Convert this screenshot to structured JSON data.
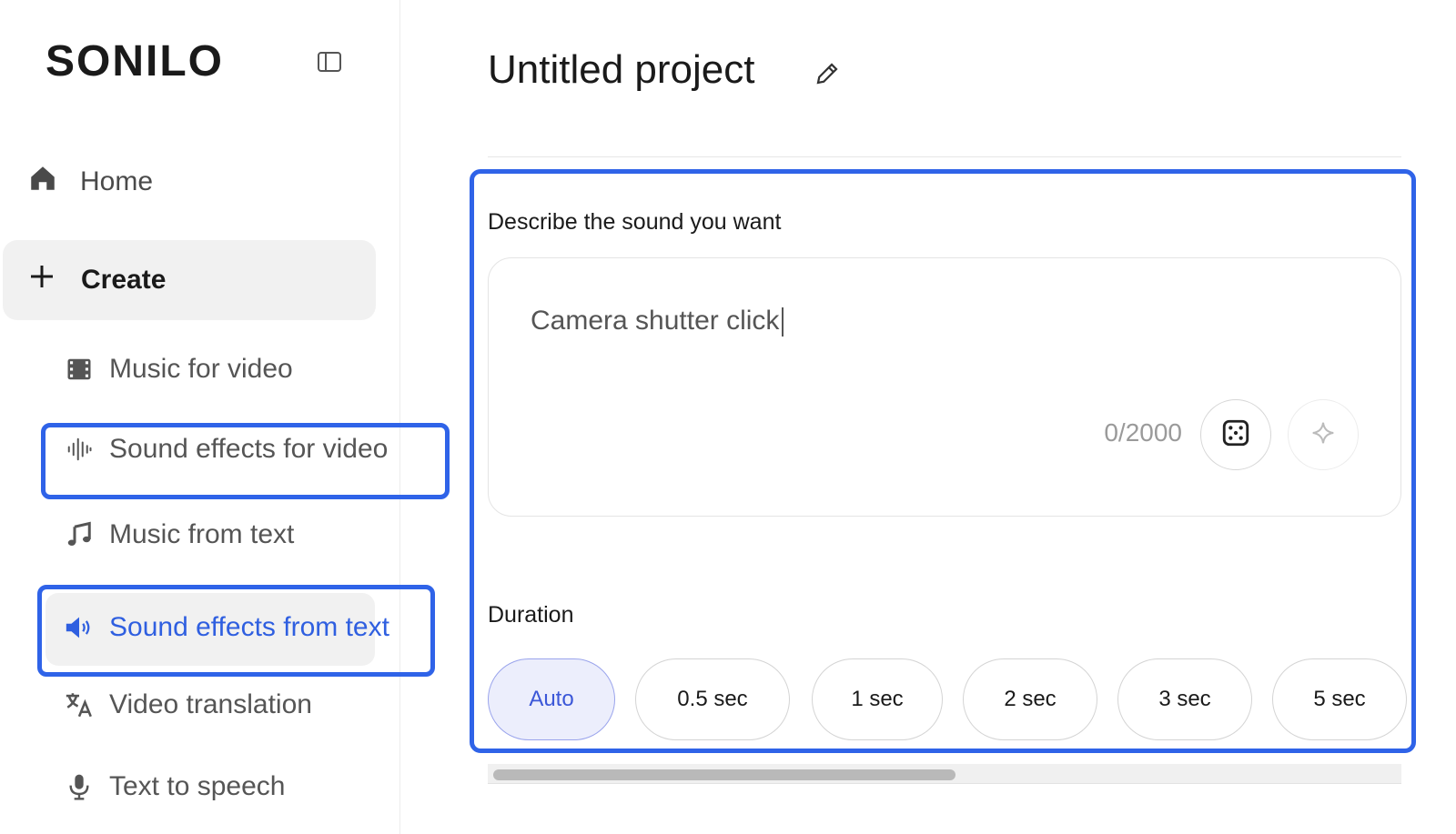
{
  "sidebar": {
    "brand": "SONILO",
    "home_label": "Home",
    "create_label": "Create",
    "items": [
      {
        "label": "Music for video",
        "icon": "film-icon"
      },
      {
        "label": "Sound effects for video",
        "icon": "waveform-icon"
      },
      {
        "label": "Music from text",
        "icon": "music-note-icon"
      },
      {
        "label": "Sound effects from text",
        "icon": "speaker-icon",
        "active": true
      },
      {
        "label": "Video translation",
        "icon": "translate-icon"
      },
      {
        "label": "Text to speech",
        "icon": "microphone-icon"
      }
    ]
  },
  "main": {
    "project_title": "Untitled project",
    "prompt": {
      "label": "Describe the sound you want",
      "value": "Camera shutter click",
      "char_count": "0/2000"
    },
    "duration": {
      "label": "Duration",
      "options": [
        "Auto",
        "0.5 sec",
        "1 sec",
        "2 sec",
        "3 sec",
        "5 sec"
      ],
      "selected": "Auto"
    }
  },
  "colors": {
    "accent": "#2f63e8",
    "active_text": "#2f5fe0",
    "selected_chip_bg": "#eceefc"
  }
}
